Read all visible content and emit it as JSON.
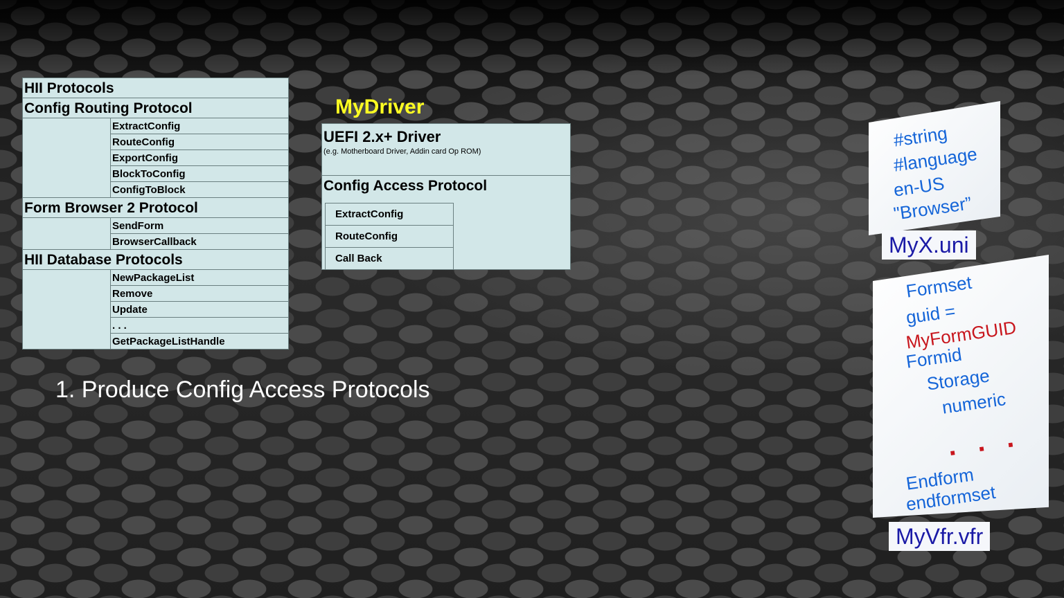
{
  "hii": {
    "title": "HII Protocols",
    "routing": {
      "title": "Config Routing Protocol",
      "items": [
        "ExtractConfig",
        "RouteConfig",
        "ExportConfig",
        "BlockToConfig",
        "ConfigToBlock"
      ]
    },
    "browser": {
      "title": "Form Browser 2 Protocol",
      "items": [
        "SendForm",
        "BrowserCallback"
      ]
    },
    "database": {
      "title": "HII Database  Protocols",
      "items": [
        "NewPackageList",
        "Remove",
        "Update",
        ". . .",
        "GetPackageListHandle"
      ]
    }
  },
  "driver": {
    "name": "MyDriver",
    "title": "UEFI 2.x+ Driver",
    "subtitle": "(e.g. Motherboard  Driver,  Addin card  Op ROM)",
    "protocol_title": "Config Access  Protocol",
    "items": [
      "ExtractConfig",
      "RouteConfig",
      "Call  Back"
    ]
  },
  "caption": "1. Produce Config Access Protocols",
  "uni_card": {
    "lines": [
      "#string",
      "#language",
      "en-US",
      "\"Browser”"
    ],
    "filename": "MyX.uni"
  },
  "vfr_card": {
    "lines": [
      "Formset",
      "guid  =",
      "MyFormGUID",
      "Formid",
      "Storage",
      "numeric"
    ],
    "dots": ". . .",
    "end_lines": [
      "Endform",
      "endformset"
    ],
    "filename": "MyVfr.vfr"
  },
  "colors": {
    "table_bg": "#d2e7e8",
    "driver_name": "#ffff22",
    "card_text": "#1565d8",
    "card_highlight": "#c8161d",
    "filename_text": "#1a1aa6"
  }
}
